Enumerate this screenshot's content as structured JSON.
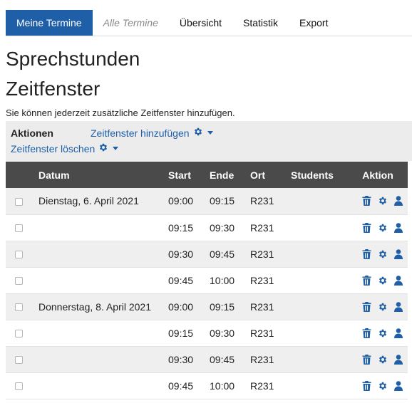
{
  "tabs": [
    {
      "label": "Meine Termine",
      "active": true
    },
    {
      "label": "Alle Termine",
      "active": false
    },
    {
      "label": "Übersicht",
      "active": false
    },
    {
      "label": "Statistik",
      "active": false
    },
    {
      "label": "Export",
      "active": false
    }
  ],
  "page": {
    "title": "Sprechstunden",
    "subtitle": "Zeitfenster",
    "intro": "Sie können jederzeit zusätzliche Zeitfenster hinzufügen."
  },
  "actions": {
    "label": "Aktionen",
    "add": "Zeitfenster hinzufügen",
    "delete": "Zeitfenster löschen"
  },
  "table": {
    "headers": {
      "datum": "Datum",
      "start": "Start",
      "ende": "Ende",
      "ort": "Ort",
      "students": "Students",
      "aktion": "Aktion"
    },
    "rows": [
      {
        "datum": "Dienstag, 6. April 2021",
        "start": "09:00",
        "ende": "09:15",
        "ort": "R231"
      },
      {
        "datum": "",
        "start": "09:15",
        "ende": "09:30",
        "ort": "R231"
      },
      {
        "datum": "",
        "start": "09:30",
        "ende": "09:45",
        "ort": "R231"
      },
      {
        "datum": "",
        "start": "09:45",
        "ende": "10:00",
        "ort": "R231"
      },
      {
        "datum": "Donnerstag, 8. April 2021",
        "start": "09:00",
        "ende": "09:15",
        "ort": "R231"
      },
      {
        "datum": "",
        "start": "09:15",
        "ende": "09:30",
        "ort": "R231"
      },
      {
        "datum": "",
        "start": "09:30",
        "ende": "09:45",
        "ort": "R231"
      },
      {
        "datum": "",
        "start": "09:45",
        "ende": "10:00",
        "ort": "R231"
      }
    ]
  },
  "colors": {
    "accent": "#1f5fa8",
    "header_bg": "#4a4a4a",
    "stripe": "#efefef",
    "actions_bg": "#ececec"
  },
  "icons": {
    "delete": "trash-icon",
    "settings": "gear-icon",
    "user": "user-icon",
    "dropdown": "caret-down-icon"
  }
}
